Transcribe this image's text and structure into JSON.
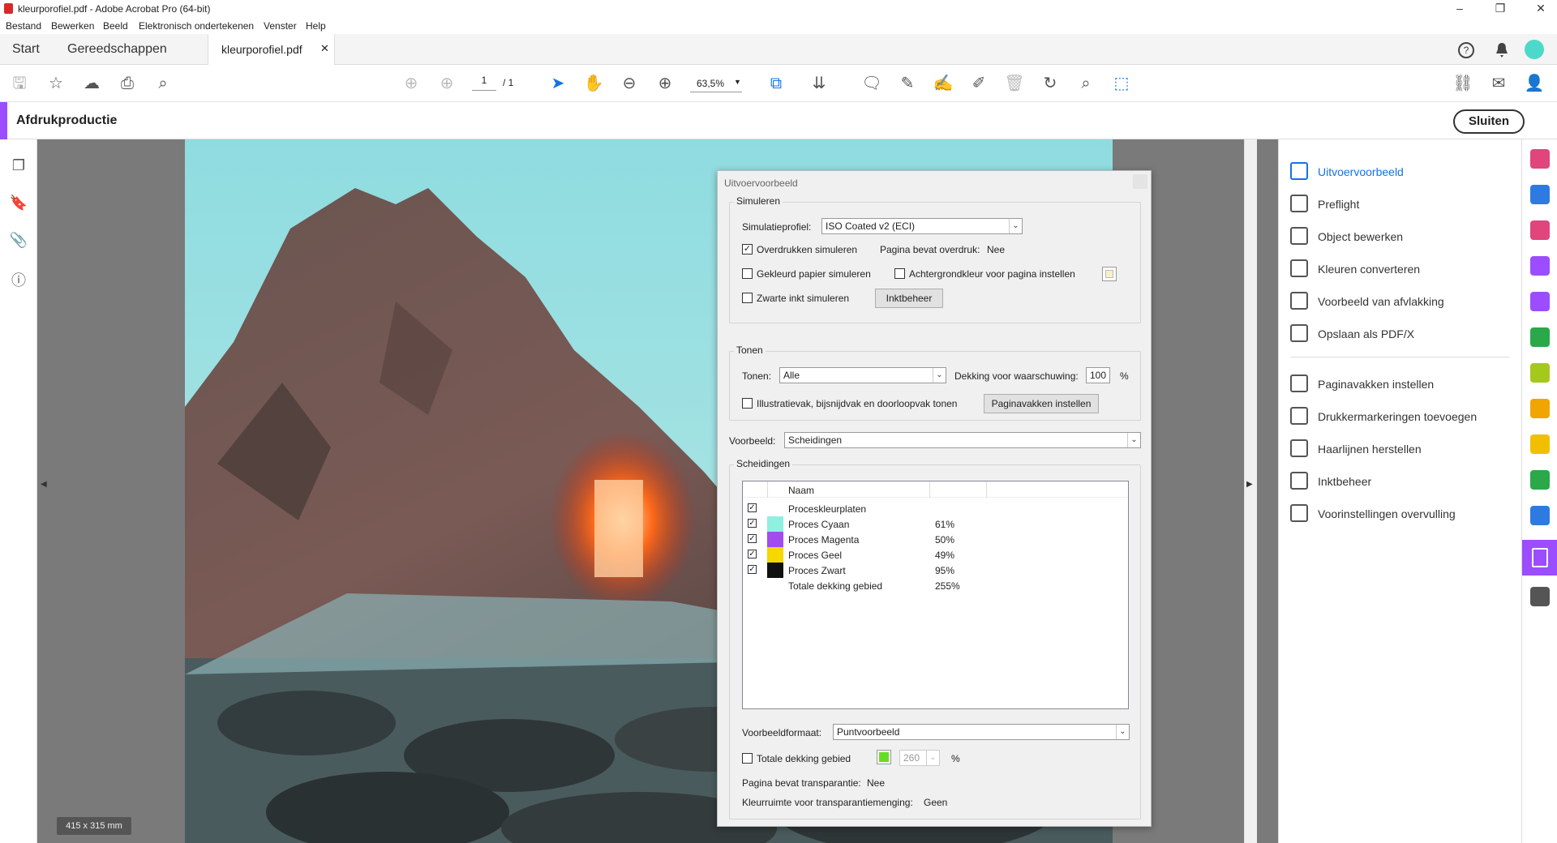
{
  "window": {
    "title": "kleurporofiel.pdf - Adobe Acrobat Pro (64-bit)"
  },
  "menu": [
    "Bestand",
    "Bewerken",
    "Beeld",
    "Elektronisch ondertekenen",
    "Venster",
    "Help"
  ],
  "tabs": {
    "start": "Start",
    "tools": "Gereedschappen",
    "document": "kleurporofiel.pdf"
  },
  "toolbar": {
    "page_current": "1",
    "page_total": "/ 1",
    "zoom": "63,5%"
  },
  "pane": {
    "title": "Afdrukproductie",
    "close_label": "Sluiten"
  },
  "document": {
    "size_label": "415 x 315 mm"
  },
  "right_panel": {
    "items": [
      {
        "label": "Uitvoervoorbeeld",
        "icon": "output-preview-icon",
        "active": true
      },
      {
        "label": "Preflight",
        "icon": "preflight-icon"
      },
      {
        "label": "Object bewerken",
        "icon": "edit-object-icon"
      },
      {
        "label": "Kleuren converteren",
        "icon": "convert-colors-icon"
      },
      {
        "label": "Voorbeeld van afvlakking",
        "icon": "flattener-preview-icon"
      },
      {
        "label": "Opslaan als PDF/X",
        "icon": "save-pdfx-icon"
      },
      {
        "label": "Paginavakken instellen",
        "icon": "page-boxes-icon"
      },
      {
        "label": "Drukkermarkeringen toevoegen",
        "icon": "printer-marks-icon"
      },
      {
        "label": "Haarlijnen herstellen",
        "icon": "fix-hairlines-icon"
      },
      {
        "label": "Inktbeheer",
        "icon": "ink-manager-icon"
      },
      {
        "label": "Voorinstellingen overvulling",
        "icon": "trap-presets-icon"
      }
    ]
  },
  "right_rail_colors": [
    "#e0457b",
    "#2d7be0",
    "#e0457b",
    "#9b4dff",
    "#9b4dff",
    "#2ba84a",
    "#a5c81d",
    "#f0a500",
    "#f0c000",
    "#2ba84a",
    "#2d7be0",
    "#ffffff",
    "#555555"
  ],
  "dialog": {
    "title": "Uitvoervoorbeeld",
    "simulate": {
      "group": "Simuleren",
      "profile_label": "Simulatieprofiel:",
      "profile_value": "ISO Coated v2 (ECI)",
      "overprint_label": "Overdrukken simuleren",
      "overprint_checked": true,
      "page_overprint_label": "Pagina bevat overdruk:",
      "page_overprint_value": "Nee",
      "paper_color_label": "Gekleurd papier simuleren",
      "bg_color_label": "Achtergrondkleur voor pagina instellen",
      "black_ink_label": "Zwarte inkt simuleren",
      "ink_manager_button": "Inktbeheer"
    },
    "tones": {
      "group": "Tonen",
      "tones_label": "Tonen:",
      "tones_value": "Alle",
      "coverage_label": "Dekking voor waarschuwing:",
      "coverage_value": "100",
      "coverage_unit": "%",
      "boxes_label": "Illustratievak, bijsnijdvak en doorloopvak tonen",
      "boxes_button": "Paginavakken instellen"
    },
    "preview": {
      "label": "Voorbeeld:",
      "value": "Scheidingen"
    },
    "separations": {
      "group": "Scheidingen",
      "header_name": "Naam",
      "rows": [
        {
          "name": "Proceskleurplaten",
          "percent": "",
          "color": "",
          "checked": true
        },
        {
          "name": "Proces Cyaan",
          "percent": "61%",
          "color": "#8ff0e0",
          "checked": true
        },
        {
          "name": "Proces Magenta",
          "percent": "50%",
          "color": "#a04cf0",
          "checked": true
        },
        {
          "name": "Proces Geel",
          "percent": "49%",
          "color": "#f5d800",
          "checked": true
        },
        {
          "name": "Proces Zwart",
          "percent": "95%",
          "color": "#111111",
          "checked": true
        },
        {
          "name": "Totale dekking gebied",
          "percent": "255%",
          "color": "",
          "checked": false
        }
      ]
    },
    "format": {
      "label": "Voorbeeldformaat:",
      "value": "Puntvoorbeeld"
    },
    "total_coverage": {
      "label": "Totale dekking gebied",
      "value": "260",
      "unit": "%",
      "color": "#66dd22"
    },
    "transparency": {
      "label": "Pagina bevat transparantie:",
      "value": "Nee"
    },
    "blend_space": {
      "label": "Kleurruimte voor transparantiemenging:",
      "value": "Geen"
    }
  }
}
